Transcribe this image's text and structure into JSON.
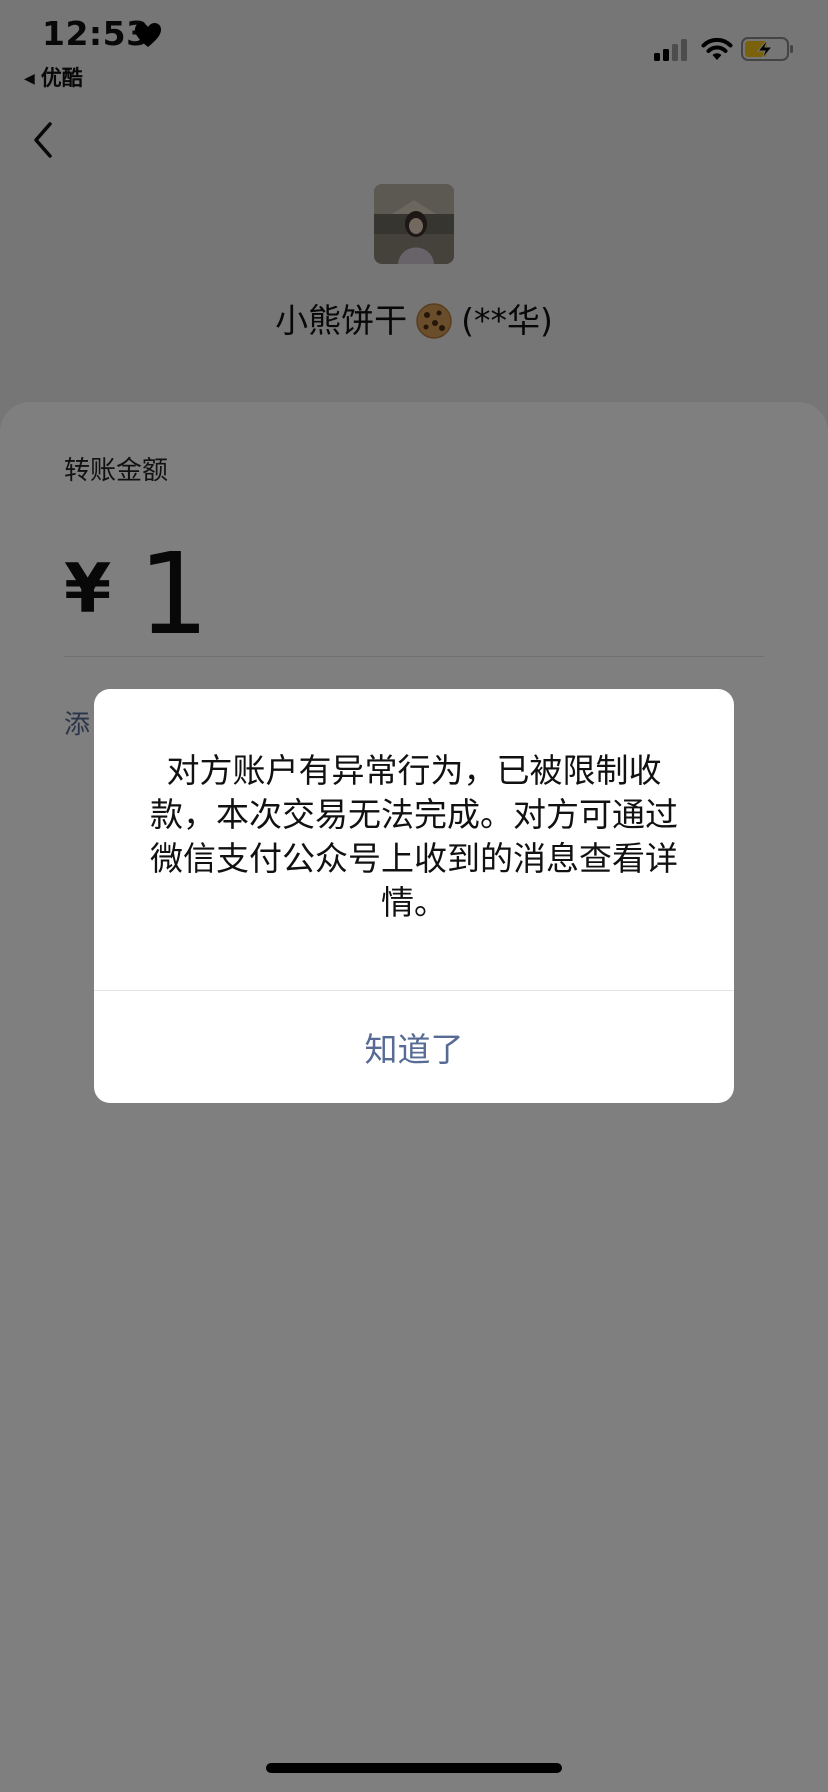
{
  "status_bar": {
    "time": "12:53",
    "back_app": "优酷",
    "icons": [
      "heart-icon",
      "cellular-signal-icon",
      "wifi-icon",
      "battery-charging-icon"
    ]
  },
  "nav": {
    "back_icon": "chevron-left-icon"
  },
  "payee": {
    "name": "小熊饼干",
    "emoji": "🍪",
    "masked_real_name": "(**华)"
  },
  "transfer": {
    "amount_label": "转账金额",
    "currency_symbol": "¥",
    "amount": "1",
    "add_note_partial": "添"
  },
  "dialog": {
    "message": "对方账户有异常行为，已被限制收款，本次交易无法完成。对方可通过微信支付公众号上收到的消息查看详情。",
    "button_label": "知道了"
  },
  "colors": {
    "page_background": "#ededed",
    "card_background": "#ffffff",
    "link_blue": "#576b95",
    "overlay": "rgba(0,0,0,0.5)"
  }
}
